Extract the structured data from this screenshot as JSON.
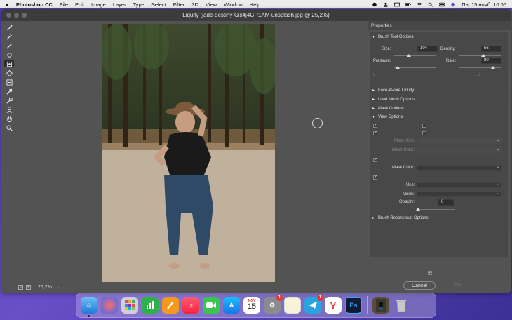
{
  "menubar": {
    "app_name": "Photoshop CC",
    "items": [
      "File",
      "Edit",
      "Image",
      "Layer",
      "Type",
      "Select",
      "Filter",
      "3D",
      "View",
      "Window",
      "Help"
    ],
    "datetime": "Пн, 15 нояб.  10:55"
  },
  "window": {
    "title": "Liquify (jade-destiny-Cix4j4GP1AM-unsplash.jpg @ 25,2%)"
  },
  "status": {
    "zoom": "25,2%"
  },
  "properties": {
    "header": "Properties",
    "brush_tool_options": {
      "title": "Brush Tool Options",
      "size_label": "Size:",
      "size_value": "104",
      "density_label": "Density:",
      "density_value": "56",
      "pressure_label": "Pressure:",
      "rate_label": "Rate:",
      "rate_value": "80",
      "size_fraction": 0.35,
      "density_fraction": 0.56,
      "rate_fraction": 0.8
    },
    "face_aware": "Face-Aware Liquify",
    "load_mesh": "Load Mesh Options",
    "mask_options": "Mask Options",
    "view_options": {
      "title": "View Options",
      "mesh_size_label": "Mesh Size:",
      "mesh_color_label": "Mesh Color:",
      "mask_color_label": "Mask Color:",
      "use_label": "Use:",
      "mode_label": "Mode:",
      "opacity_label": "Opacity:",
      "opacity_value": "0"
    },
    "brush_reconstruct": "Brush Reconstruct Options",
    "cancel_label": "Cancel",
    "ok_label": "OK"
  },
  "dock": {
    "calendar_month": "NOV",
    "calendar_day": "15",
    "badges": [
      "1",
      "1"
    ],
    "ps_label": "Ps"
  },
  "colors": {
    "panel": "#535353",
    "accent": "#e53935"
  }
}
